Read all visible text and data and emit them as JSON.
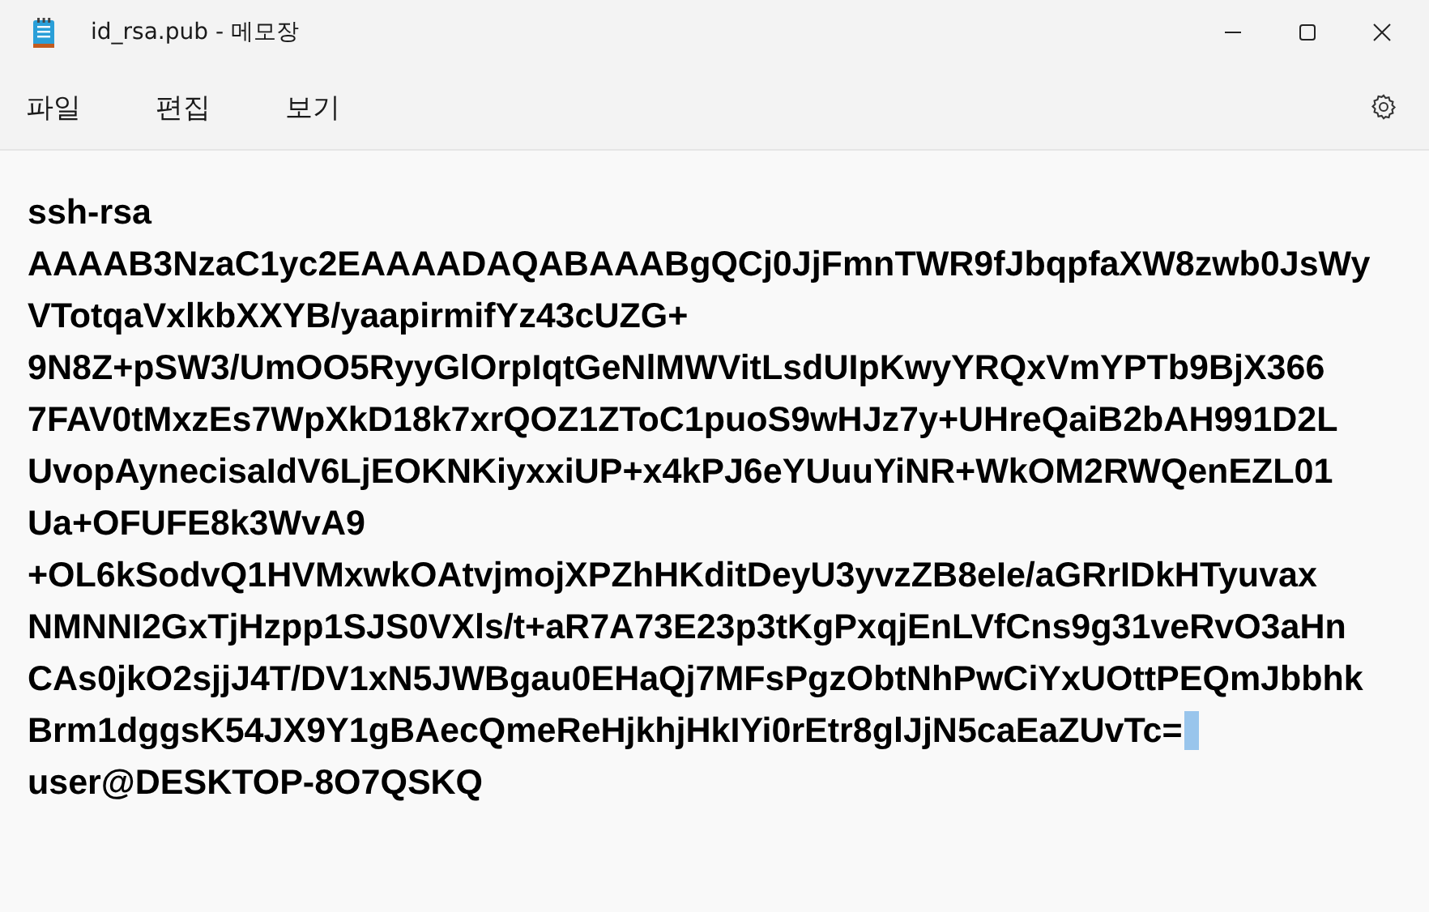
{
  "window": {
    "title": "id_rsa.pub - 메모장"
  },
  "menu": [
    {
      "label": "파일"
    },
    {
      "label": "편집"
    },
    {
      "label": "보기"
    }
  ],
  "document": {
    "lines": [
      {
        "text": "ssh-rsa",
        "selected_end": false
      },
      {
        "text": "AAAAB3NzaC1yc2EAAAADAQABAAABgQCj0JjFmnTWR9fJbqpfaXW8zwb0JsWy",
        "selected_end": false
      },
      {
        "text": "VTotqaVxlkbXXYB/yaapirmifYz43cUZG+",
        "selected_end": false
      },
      {
        "text": "9N8Z+pSW3/UmOO5RyyGlOrpIqtGeNlMWVitLsdUIpKwyYRQxVmYPTb9BjX366",
        "selected_end": false
      },
      {
        "text": "7FAV0tMxzEs7WpXkD18k7xrQOZ1ZToC1puoS9wHJz7y+UHreQaiB2bAH991D2L",
        "selected_end": false
      },
      {
        "text": "UvopAynecisaIdV6LjEOKNKiyxxiUP+x4kPJ6eYUuuYiNR+WkOM2RWQenEZL01",
        "selected_end": false
      },
      {
        "text": "Ua+OFUFE8k3WvA9",
        "selected_end": false
      },
      {
        "text": "+OL6kSodvQ1HVMxwkOAtvjmojXPZhHKditDeyU3yvzZB8eIe/aGRrIDkHTyuvax",
        "selected_end": false
      },
      {
        "text": "NMNNI2GxTjHzpp1SJS0VXls/t+aR7A73E23p3tKgPxqjEnLVfCns9g31veRvO3aHn",
        "selected_end": false
      },
      {
        "text": "CAs0jkO2sjjJ4T/DV1xN5JWBgau0EHaQj7MFsPgzObtNhPwCiYxUOttPEQmJbbhk",
        "selected_end": false
      },
      {
        "text": "Brm1dggsK54JX9Y1gBAecQmeReHjkhjHkIYi0rEtr8glJjN5caEaZUvTc=",
        "selected_end": true
      },
      {
        "text": "user@DESKTOP-8O7QSKQ",
        "selected_end": false
      }
    ]
  }
}
